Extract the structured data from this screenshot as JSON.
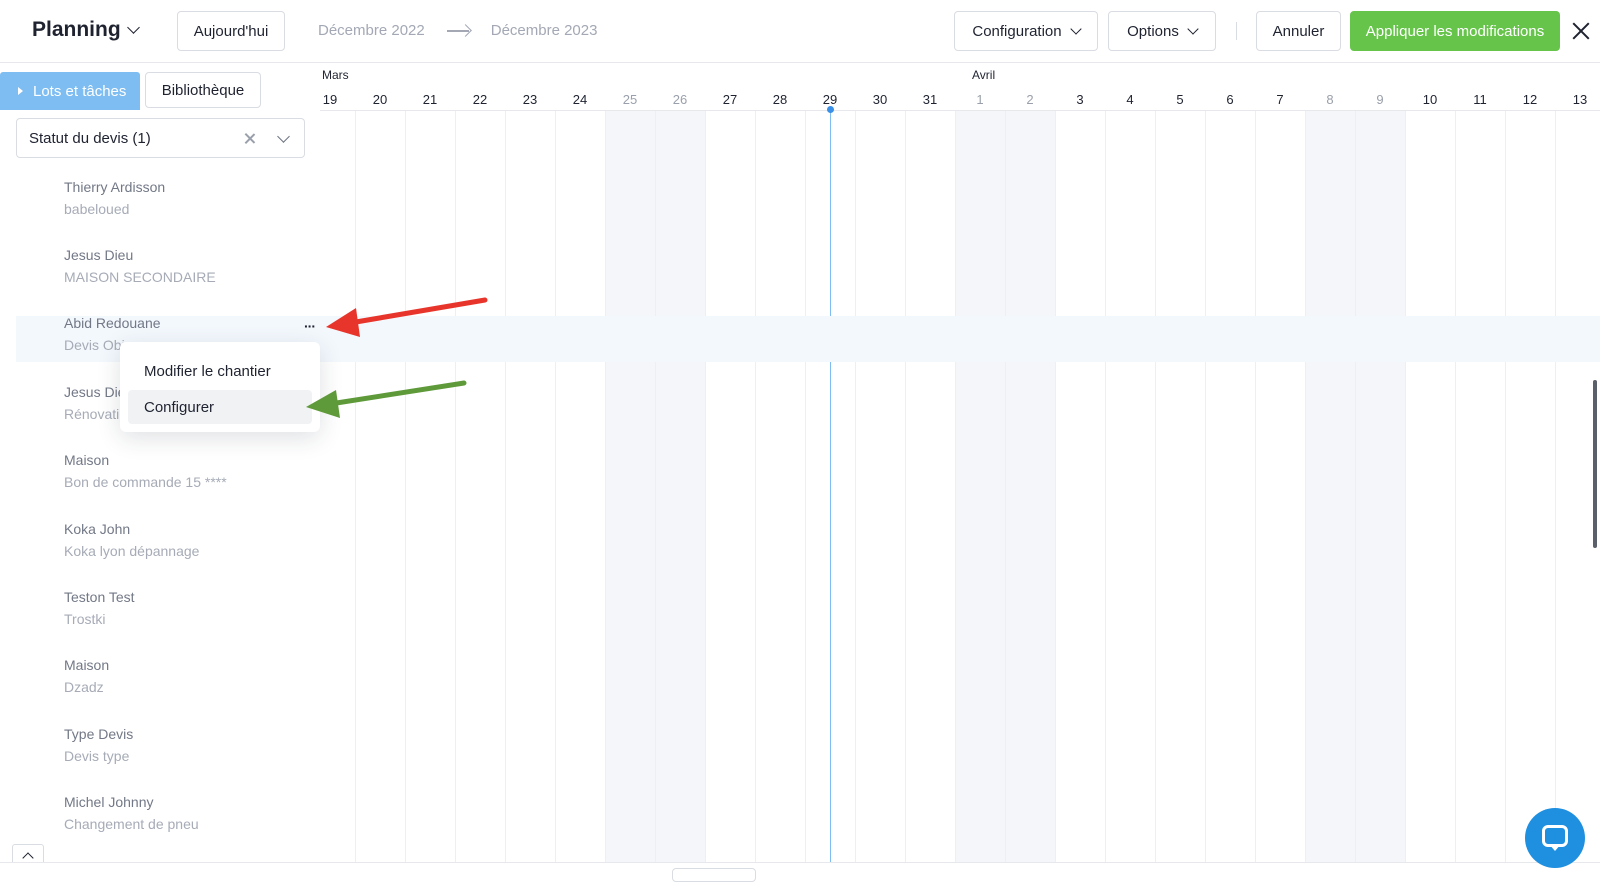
{
  "header": {
    "title": "Planning",
    "today_label": "Aujourd'hui",
    "date_start": "Décembre 2022",
    "date_end": "Décembre 2023",
    "configuration_label": "Configuration",
    "options_label": "Options",
    "cancel_label": "Annuler",
    "apply_label": "Appliquer les modifications",
    "apply_color": "#66c44a"
  },
  "left_panel": {
    "tab_active": "Lots et tâches",
    "tab_library": "Bibliothèque",
    "filter_label": "Statut du devis (1)",
    "more_label": "···",
    "projects": [
      {
        "name": "Thierry Ardisson",
        "sub": "babeloued"
      },
      {
        "name": "Jesus Dieu",
        "sub": "MAISON SECONDAIRE"
      },
      {
        "name": "Abid Redouane",
        "sub": "Devis Obi..."
      },
      {
        "name": "Jesus Die",
        "sub": "Rénovati"
      },
      {
        "name": "Maison",
        "sub": "Bon de commande 15 ****"
      },
      {
        "name": "Koka John",
        "sub": "Koka lyon dépannage"
      },
      {
        "name": "Teston Test",
        "sub": "Trostki"
      },
      {
        "name": "Maison",
        "sub": "Dzadz"
      },
      {
        "name": "Type Devis",
        "sub": "Devis type"
      },
      {
        "name": "Michel Johnny",
        "sub": "Changement de pneu"
      }
    ]
  },
  "context_menu": {
    "items": [
      "Modifier le chantier",
      "Configurer"
    ]
  },
  "timeline": {
    "months": [
      {
        "label": "Mars",
        "start_index": 0
      },
      {
        "label": "Avril",
        "start_index": 13
      }
    ],
    "days": [
      {
        "label": "19",
        "weekend": false
      },
      {
        "label": "20",
        "weekend": false
      },
      {
        "label": "21",
        "weekend": false
      },
      {
        "label": "22",
        "weekend": false
      },
      {
        "label": "23",
        "weekend": false
      },
      {
        "label": "24",
        "weekend": false
      },
      {
        "label": "25",
        "weekend": true
      },
      {
        "label": "26",
        "weekend": true
      },
      {
        "label": "27",
        "weekend": false
      },
      {
        "label": "28",
        "weekend": false
      },
      {
        "label": "29",
        "weekend": false
      },
      {
        "label": "30",
        "weekend": false
      },
      {
        "label": "31",
        "weekend": false
      },
      {
        "label": "1",
        "weekend": true
      },
      {
        "label": "2",
        "weekend": true
      },
      {
        "label": "3",
        "weekend": false
      },
      {
        "label": "4",
        "weekend": false
      },
      {
        "label": "5",
        "weekend": false
      },
      {
        "label": "6",
        "weekend": false
      },
      {
        "label": "7",
        "weekend": false
      },
      {
        "label": "8",
        "weekend": true
      },
      {
        "label": "9",
        "weekend": true
      },
      {
        "label": "10",
        "weekend": false
      },
      {
        "label": "11",
        "weekend": false
      },
      {
        "label": "12",
        "weekend": false
      },
      {
        "label": "13",
        "weekend": false
      }
    ],
    "today_index": 10,
    "today_color": "#3a8fe6"
  },
  "annotations": {
    "red_arrow_color": "#e8352b",
    "green_arrow_color": "#5f9a3a"
  }
}
